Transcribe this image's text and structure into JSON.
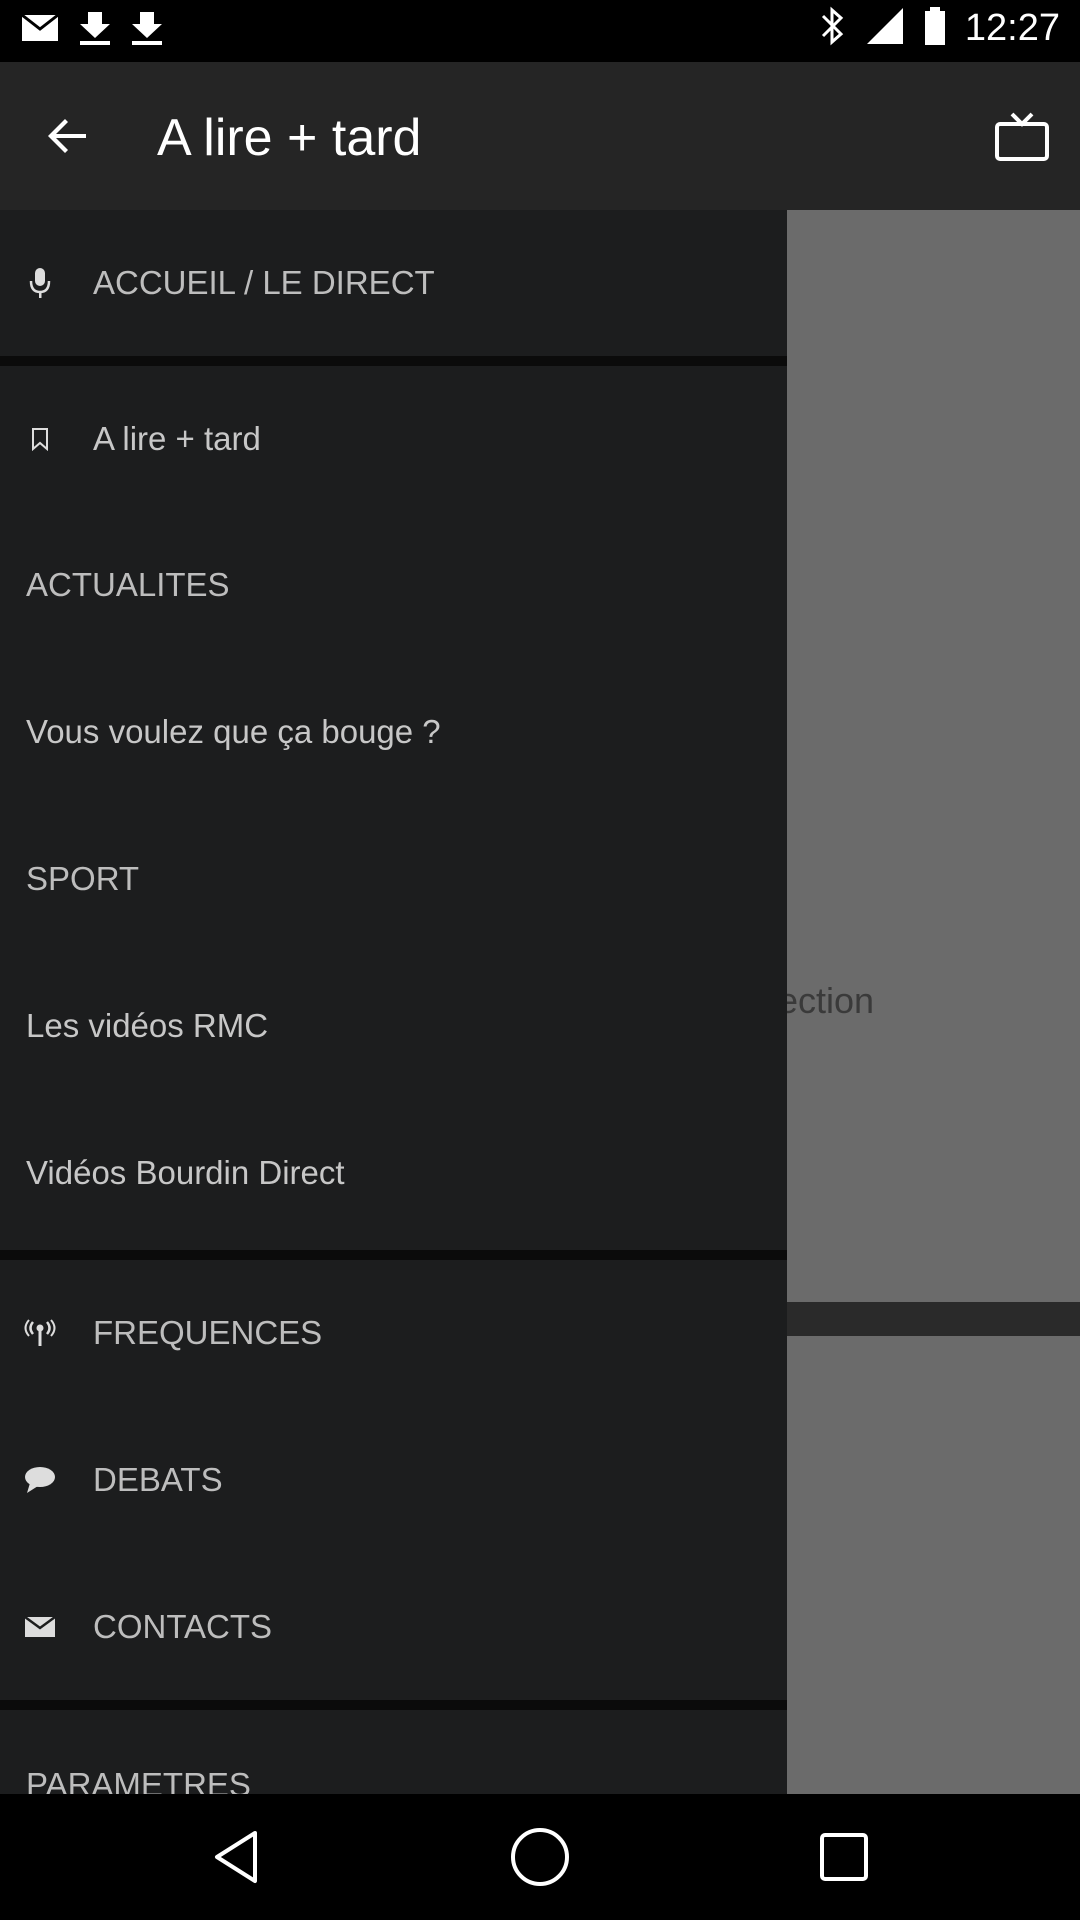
{
  "status_bar": {
    "time": "12:27",
    "icons": [
      "mail-icon",
      "download-icon",
      "bluetooth-icon",
      "signal-icon",
      "battery-icon"
    ]
  },
  "appbar": {
    "title": "A lire + tard",
    "back_icon": "arrow-back-icon",
    "tv_icon": "tv-icon"
  },
  "content": {
    "partial_text": "section"
  },
  "drawer": {
    "items": [
      {
        "label": "ACCUEIL / LE DIRECT",
        "icon": "microphone-icon"
      },
      {
        "label": "A lire + tard",
        "icon": "bookmark-icon"
      },
      {
        "label": "ACTUALITES"
      },
      {
        "label": "Vous voulez que ça bouge ?"
      },
      {
        "label": "SPORT"
      },
      {
        "label": "Les vidéos RMC"
      },
      {
        "label": "Vidéos Bourdin Direct"
      },
      {
        "label": "FREQUENCES",
        "icon": "antenna-icon"
      },
      {
        "label": "DEBATS",
        "icon": "chat-bubble-icon"
      },
      {
        "label": "CONTACTS",
        "icon": "envelope-icon"
      },
      {
        "label": "PARAMETRES"
      }
    ]
  },
  "colors": {
    "drawer_bg": "#1c1d1e",
    "appbar_bg": "#252525",
    "scrim": "#6b6b6b"
  },
  "navbar": {
    "icons": [
      "back-triangle-icon",
      "home-circle-icon",
      "recents-square-icon"
    ]
  }
}
